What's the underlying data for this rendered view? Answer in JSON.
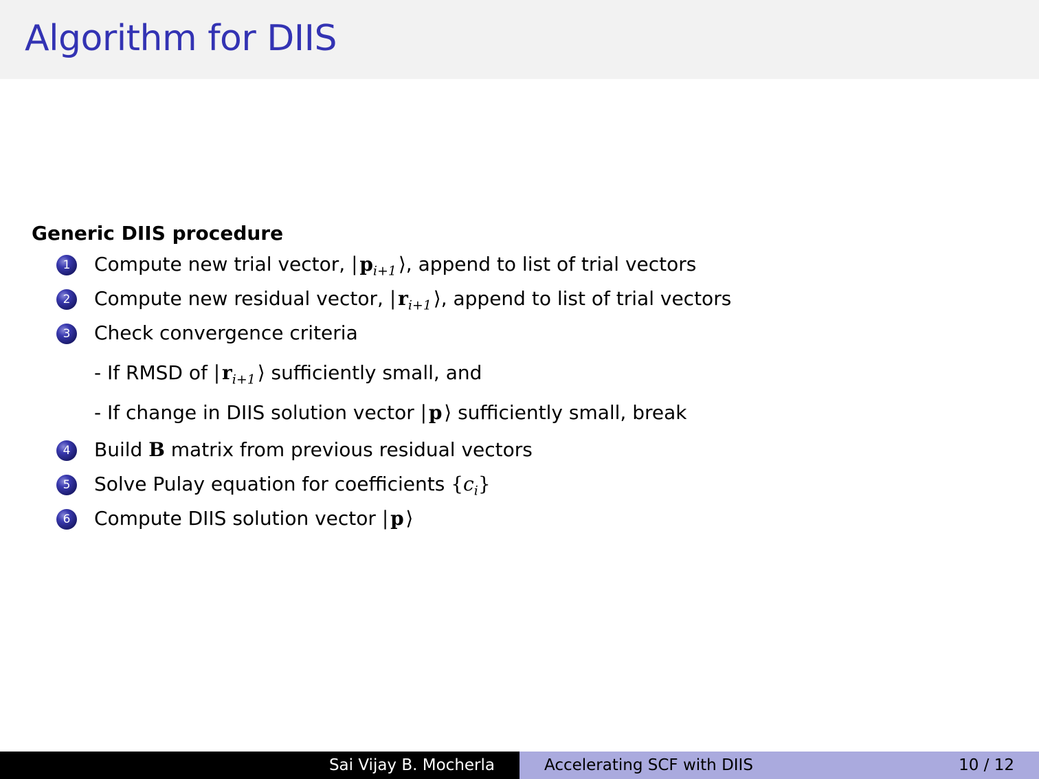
{
  "slide": {
    "title": "Algorithm for DIIS",
    "block_title": "Generic DIIS procedure",
    "steps": [
      {
        "number": "1",
        "before": "Compute new trial vector, ",
        "math": "| p_{i+1} ⟩",
        "after": ", append to list of trial vectors"
      },
      {
        "number": "2",
        "before": "Compute new residual vector, ",
        "math": "| r_{i+1} ⟩",
        "after": ", append to list of trial vectors"
      },
      {
        "number": "3",
        "before": "Check convergence criteria",
        "math": "",
        "after": ""
      },
      {
        "number": "4",
        "before": "Build ",
        "math": "B",
        "after": " matrix from previous residual vectors"
      },
      {
        "number": "5",
        "before": "Solve Pulay equation for coefficients ",
        "math": "{c_i}",
        "after": ""
      },
      {
        "number": "6",
        "before": "Compute DIIS solution vector ",
        "math": "| p ⟩",
        "after": ""
      }
    ],
    "substeps": [
      {
        "before": "- If RMSD of ",
        "math": "| r_{i+1} ⟩",
        "after": " sufficiently small, and"
      },
      {
        "before": "- If change in DIIS solution vector ",
        "math": "| p ⟩",
        "after": " sufficiently small, break"
      }
    ]
  },
  "footer": {
    "author": "Sai Vijay B. Mocherla",
    "talk_title": "Accelerating SCF with DIIS",
    "page": "10 / 12"
  },
  "colors": {
    "title": "#3333b3",
    "title_bar": "#f2f2f2",
    "footer_left": "#000000",
    "footer_right": "#aaaade",
    "bullet": "#1a1a6a"
  }
}
